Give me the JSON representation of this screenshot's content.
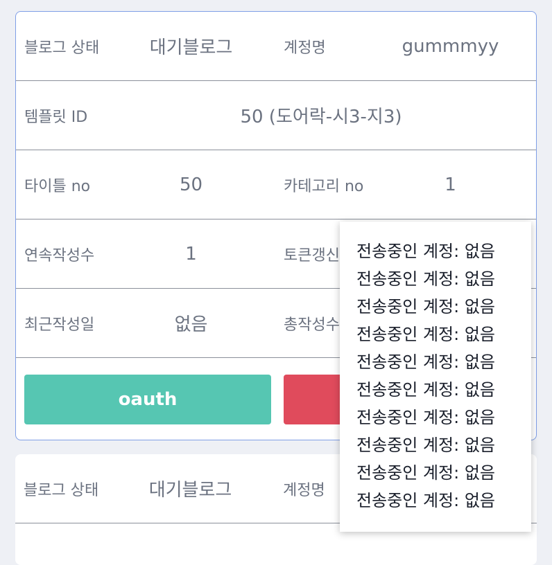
{
  "card1": {
    "blog_status_label": "블로그 상태",
    "blog_status_value": "대기블로그",
    "account_label": "계정명",
    "account_value": "gummmyy",
    "template_label": "템플릿 ID",
    "template_value": "50 (도어락-시3-지3)",
    "title_no_label": "타이틀 no",
    "title_no_value": "50",
    "category_no_label": "카테고리 no",
    "category_no_value": "1",
    "consecutive_label": "연속작성수",
    "consecutive_value": "1",
    "token_label": "토큰갱신",
    "recent_label": "최근작성일",
    "recent_value": "없음",
    "total_label": "총작성수",
    "oauth_button": "oauth"
  },
  "card2": {
    "blog_status_label": "블로그 상태",
    "blog_status_value": "대기블로그",
    "account_label": "계정명"
  },
  "popup": {
    "items": [
      "전송중인 계정: 없음",
      "전송중인 계정: 없음",
      "전송중인 계정: 없음",
      "전송중인 계정: 없음",
      "전송중인 계정: 없음",
      "전송중인 계정: 없음",
      "전송중인 계정: 없음",
      "전송중인 계정: 없음",
      "전송중인 계정: 없음",
      "전송중인 계정: 없음"
    ]
  },
  "colors": {
    "card_border": "#7f9ee6",
    "oauth_button": "#56c6b2",
    "delete_button": "#e04b5c",
    "label_text": "#6b7280"
  }
}
